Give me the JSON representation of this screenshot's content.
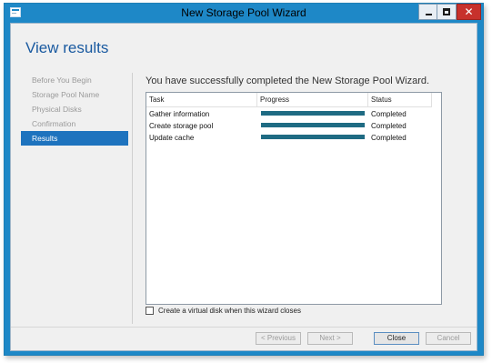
{
  "window": {
    "title": "New Storage Pool Wizard"
  },
  "page": {
    "title": "View results"
  },
  "sidebar": {
    "items": [
      {
        "label": "Before You Begin",
        "active": false
      },
      {
        "label": "Storage Pool Name",
        "active": false
      },
      {
        "label": "Physical Disks",
        "active": false
      },
      {
        "label": "Confirmation",
        "active": false
      },
      {
        "label": "Results",
        "active": true
      }
    ]
  },
  "main": {
    "heading": "You have successfully completed the New Storage Pool Wizard.",
    "table": {
      "columns": [
        "Task",
        "Progress",
        "Status"
      ],
      "rows": [
        {
          "task": "Gather information",
          "progress": 1.0,
          "status": "Completed"
        },
        {
          "task": "Create storage pool",
          "progress": 1.0,
          "status": "Completed"
        },
        {
          "task": "Update cache",
          "progress": 1.0,
          "status": "Completed"
        }
      ]
    },
    "checkbox": {
      "label": "Create a virtual disk when this wizard closes",
      "checked": false
    }
  },
  "buttons": {
    "previous": "< Previous",
    "next": "Next >",
    "close": "Close",
    "cancel": "Cancel"
  },
  "colors": {
    "titlebar": "#1e88c7",
    "accent": "#1e73be",
    "progress_fill": "#1f6b83",
    "close_button": "#c7312c"
  }
}
